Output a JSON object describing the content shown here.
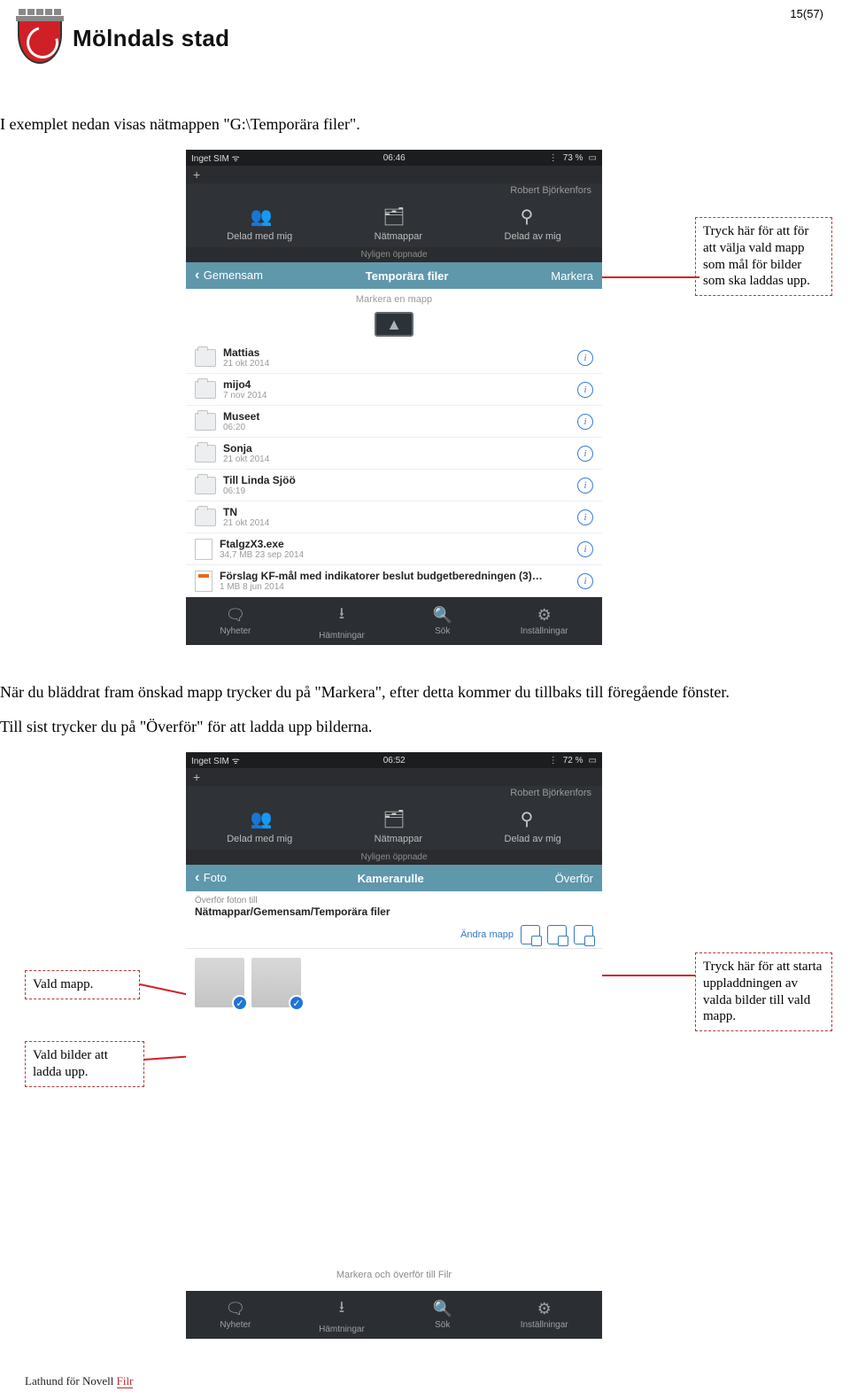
{
  "page_number": "15(57)",
  "city": "Mölndals stad",
  "paragraphs": {
    "p1": "I exemplet nedan visas nätmappen \"G:\\Temporära filer\".",
    "p2": "När du bläddrat fram önskad mapp trycker du på \"Markera\", efter detta kommer du tillbaks till föregående fönster.",
    "p3": "Till sist trycker du på \"Överför\" för att ladda upp bilderna."
  },
  "callouts": {
    "right1": "Tryck här för att för att välja vald mapp som mål för bilder som ska laddas upp.",
    "left1": "Vald mapp.",
    "left2": "Vald bilder att ladda upp.",
    "right2": "Tryck här för att starta uppladdningen av valda bilder till vald mapp."
  },
  "screenshot1": {
    "status": {
      "left": "Inget SIM ᯤ",
      "time": "06:46",
      "battery": "73 %",
      "bt": "⋮"
    },
    "plus": "+",
    "user": "Robert Björkenfors",
    "tabs": {
      "a": "Delad med mig",
      "b": "Nätmappar",
      "c": "Delad av mig"
    },
    "subline": "Nyligen öppnade",
    "bluebar": {
      "left": "Gemensam",
      "center": "Temporära filer",
      "right": "Markera"
    },
    "hint": "Markera en mapp",
    "items": [
      {
        "icon": "drag",
        "name": "▲"
      },
      {
        "icon": "folder",
        "name": "Mattias",
        "meta": "21 okt 2014"
      },
      {
        "icon": "folder",
        "name": "mijo4",
        "meta": "7 nov 2014"
      },
      {
        "icon": "folder",
        "name": "Museet",
        "meta": "06:20"
      },
      {
        "icon": "folder",
        "name": "Sonja",
        "meta": "21 okt 2014"
      },
      {
        "icon": "folder",
        "name": "Till Linda Sjöö",
        "meta": "06:19"
      },
      {
        "icon": "folder",
        "name": "TN",
        "meta": "21 okt 2014"
      },
      {
        "icon": "page",
        "name": "FtalgzX3.exe",
        "meta": "34,7 MB   23 sep 2014"
      },
      {
        "icon": "pageorange",
        "name": "Förslag KF-mål med indikatorer beslut budgetberedningen (3)…",
        "meta": "1 MB   8 jun 2014"
      }
    ],
    "bottom": {
      "a": "Nyheter",
      "b": "Hämtningar",
      "c": "Sök",
      "d": "Inställningar"
    }
  },
  "screenshot2": {
    "status": {
      "left": "Inget SIM ᯤ",
      "time": "06:52",
      "battery": "72 %",
      "bt": "⋮"
    },
    "plus": "+",
    "user": "Robert Björkenfors",
    "tabs": {
      "a": "Delad med mig",
      "b": "Nätmappar",
      "c": "Delad av mig"
    },
    "subline": "Nyligen öppnade",
    "bluebar": {
      "left": "Foto",
      "center": "Kamerarulle",
      "right": "Överför"
    },
    "dest_label": "Överför foton till",
    "dest_value": "Nätmappar/Gemensam/Temporära filer",
    "change_label": "Ändra mapp",
    "midnote": "Markera och överför till Filr",
    "bottom": {
      "a": "Nyheter",
      "b": "Hämtningar",
      "c": "Sök",
      "d": "Inställningar"
    }
  },
  "footer": {
    "text": "Lathund för Novell ",
    "link": "Filr"
  }
}
